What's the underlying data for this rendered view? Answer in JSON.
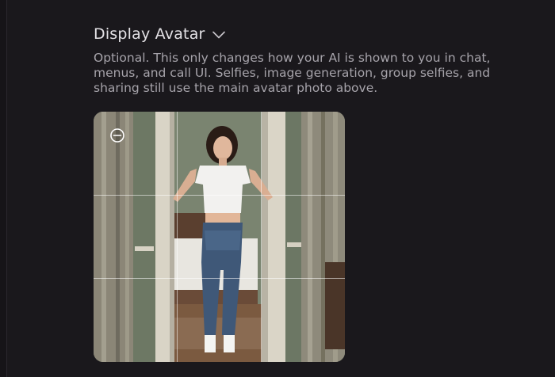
{
  "section": {
    "title": "Display Avatar",
    "description": "Optional. This only changes how your AI is shown to you in chat, menus, and call UI. Selfies, image generation, group selfies, and sharing still use the main avatar photo above."
  },
  "icons": {
    "toggle": "chevron-down-icon",
    "zoom": "zoom-out-icon"
  },
  "colors": {
    "background": "#1a181c",
    "title": "#e4e2e6",
    "description": "#a6a3aa"
  }
}
